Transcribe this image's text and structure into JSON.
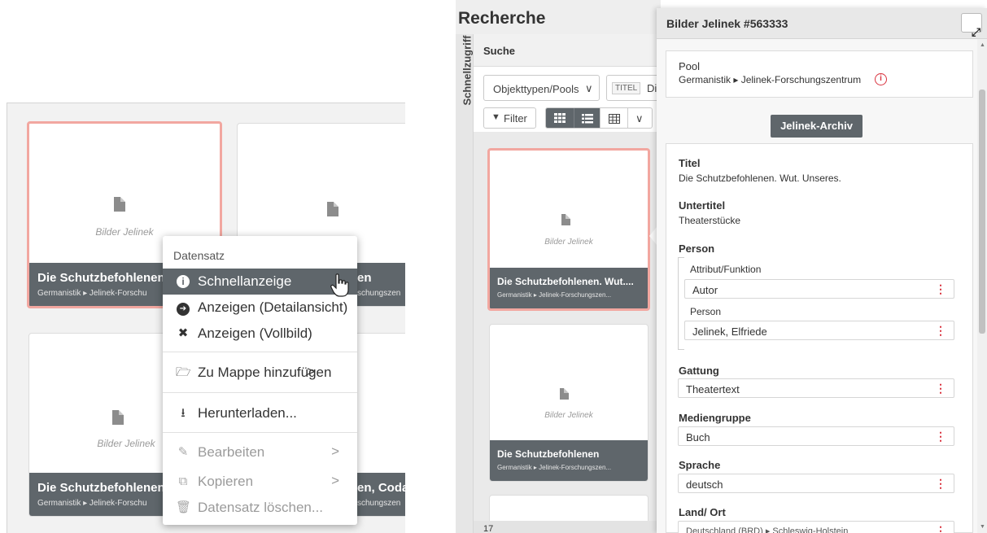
{
  "left_zoom": {
    "cards": [
      {
        "placeholder": "Bilder Jelinek",
        "title": "Die Schutzbefohlenen",
        "subtitle": "Germanistik ▸ Jelinek-Forschu"
      },
      {
        "placeholder": "Bilder Jelinek",
        "title": "en",
        "subtitle": "schungszen"
      },
      {
        "placeholder": "Bilder Jelinek",
        "title": "Die Schutzbefohlenen",
        "subtitle": "Germanistik ▸ Jelinek-Forschu"
      },
      {
        "placeholder": "k",
        "title": "en, Coda",
        "subtitle": "schungszen"
      }
    ],
    "context_menu": {
      "header": "Datensatz",
      "items": [
        {
          "icon": "info-icon",
          "glyph": "i",
          "label": "Schnellanzeige",
          "arrow": ""
        },
        {
          "icon": "arrow-circle-right-icon",
          "glyph": "➔",
          "label": "Anzeigen (Detailansicht)",
          "arrow": ""
        },
        {
          "icon": "fullscreen-icon",
          "glyph": "✖",
          "label": "Anzeigen (Vollbild)",
          "arrow": ""
        },
        {
          "icon": "folder-open-icon",
          "glyph": "🗁",
          "label": "Zu Mappe hinzufügen",
          "arrow": ">"
        },
        {
          "icon": "download-icon",
          "glyph": "⭳",
          "label": "Herunterladen...",
          "arrow": ""
        },
        {
          "icon": "pencil-icon",
          "glyph": "✎",
          "label": "Bearbeiten",
          "arrow": ">"
        },
        {
          "icon": "copy-icon",
          "glyph": "⧉",
          "label": "Kopieren",
          "arrow": ">"
        },
        {
          "icon": "trash-icon",
          "glyph": "🗑",
          "label": "Datensatz löschen...",
          "arrow": ""
        }
      ]
    }
  },
  "app": {
    "header_title": "Recherche",
    "sidebar_label": "Schnellzugriff",
    "search_tab": "Suche",
    "toolbar": {
      "objecttypes_label": "Objekttypen/Pools",
      "chevron": "∨",
      "titel_chip": "TITEL",
      "titel_value": "Di",
      "filter_label": "Filter"
    },
    "results": [
      {
        "placeholder": "Bilder Jelinek",
        "title": "Die Schutzbefohlenen. Wut....",
        "subtitle": "Germanistik ▸ Jelinek-Forschungszen..."
      },
      {
        "placeholder": "Bilder Jelinek",
        "title": "Die Schutzbefohlenen",
        "subtitle": "Germanistik ▸ Jelinek-Forschungszen..."
      }
    ],
    "count": "17",
    "detail": {
      "title": "Bilder Jelinek #563333",
      "pool_label": "Pool",
      "pool_value": "Germanistik ▸ Jelinek-Forschungszentrum",
      "tag_button": "Jelinek-Archiv",
      "fields": {
        "titel_label": "Titel",
        "titel_value": "Die Schutzbefohlenen. Wut. Unseres.",
        "untertitel_label": "Untertitel",
        "untertitel_value": "Theaterstücke",
        "person_label": "Person",
        "attribut_label": "Attribut/Funktion",
        "attribut_value": "Autor",
        "person_sub_label": "Person",
        "person_value": "Jelinek, Elfriede",
        "gattung_label": "Gattung",
        "gattung_value": "Theatertext",
        "mediengruppe_label": "Mediengruppe",
        "mediengruppe_value": "Buch",
        "sprache_label": "Sprache",
        "sprache_value": "deutsch",
        "land_label": "Land/ Ort",
        "land_value": "Deutschland (BRD) ▸ Schleswig-Holstein"
      }
    }
  },
  "colors": {
    "card_bar": "#5f666b",
    "selection_border": "#f2a7a0",
    "menu_active": "#5f666b",
    "accent_red": "#d9333f"
  }
}
